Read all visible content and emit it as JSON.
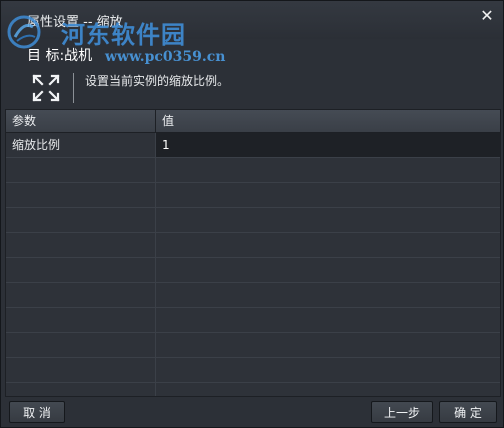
{
  "window": {
    "title": "属性设置 -- 缩放",
    "close_label": "✕"
  },
  "watermark": {
    "site_name": "河东软件园",
    "site_url": "www.pc0359.cn"
  },
  "target": {
    "prefix": "目  标",
    "sep": ":",
    "value": "战机"
  },
  "description": "设置当前实例的缩放比例。",
  "grid": {
    "headers": [
      "参数",
      "值"
    ],
    "rows": [
      {
        "name": "缩放比例",
        "value": "1"
      }
    ]
  },
  "buttons": {
    "cancel": "取 消",
    "prev": "上一步",
    "ok": "确 定"
  },
  "colors": {
    "background": "#2b2f36",
    "watermark": "#3f8dd6"
  }
}
